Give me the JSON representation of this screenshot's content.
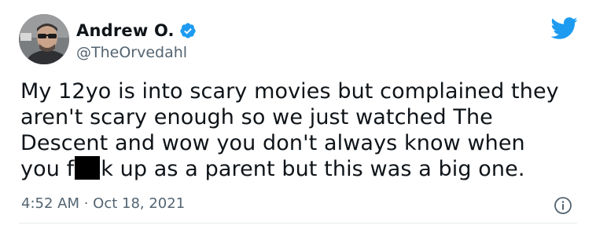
{
  "author": {
    "display_name": "Andrew O.",
    "handle": "@TheOrvedahl",
    "verified": true
  },
  "tweet": {
    "line1": "My 12yo is into scary movies but complained they",
    "line2": "aren't scary enough so we just watched The",
    "line3": "Descent and wow you don't always know when",
    "line4_start": "you f",
    "line4_end": "k up as a parent but this was a big one.",
    "timestamp": "4:52 AM · Oct 18, 2021"
  },
  "icons": {
    "brand": "twitter-bird-icon",
    "verified": "verified-badge-icon",
    "info": "info-icon"
  },
  "colors": {
    "brand_blue": "#1d9bf0",
    "text_primary": "#0f1419",
    "text_secondary": "#536471"
  }
}
